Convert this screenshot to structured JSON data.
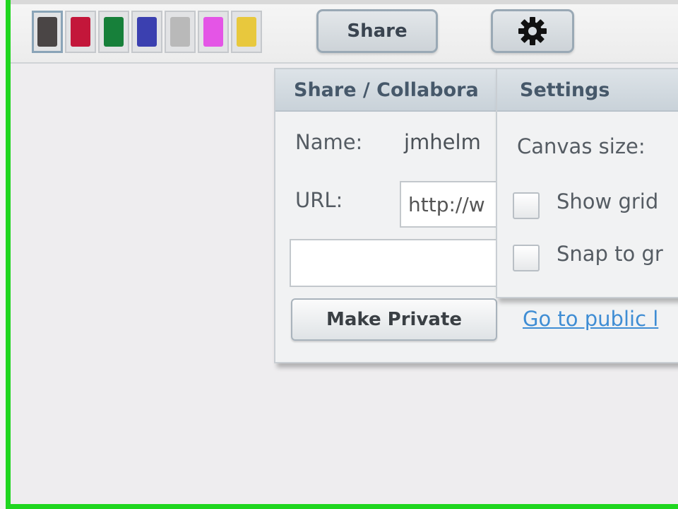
{
  "toolbar": {
    "swatches": [
      {
        "name": "swatch-dark-gray",
        "color": "#4a4545",
        "selected": true
      },
      {
        "name": "swatch-red",
        "color": "#c3163a",
        "selected": false
      },
      {
        "name": "swatch-green",
        "color": "#17803a",
        "selected": false
      },
      {
        "name": "swatch-blue",
        "color": "#3b40b0",
        "selected": false
      },
      {
        "name": "swatch-light-gray",
        "color": "#b9b9b9",
        "selected": false
      },
      {
        "name": "swatch-magenta",
        "color": "#e455e6",
        "selected": false
      },
      {
        "name": "swatch-yellow",
        "color": "#e8c83d",
        "selected": false
      }
    ],
    "share_label": "Share",
    "settings_icon": "gear-icon"
  },
  "share_panel": {
    "title": "Share / Collabora",
    "name_label": "Name:",
    "name_value": "jmhelm",
    "url_label": "URL:",
    "url_value": "http://w",
    "extra_field_value": "",
    "make_private_label": "Make Private",
    "public_link_label": "Go to public l"
  },
  "settings_panel": {
    "title": "Settings",
    "canvas_size_label": "Canvas size:",
    "show_grid_label": "Show grid",
    "show_grid_checked": false,
    "snap_to_grid_label": "Snap to gr",
    "snap_to_grid_checked": false
  },
  "colors": {
    "canvas_border": "#1fd61f",
    "link": "#3f8dd4"
  }
}
